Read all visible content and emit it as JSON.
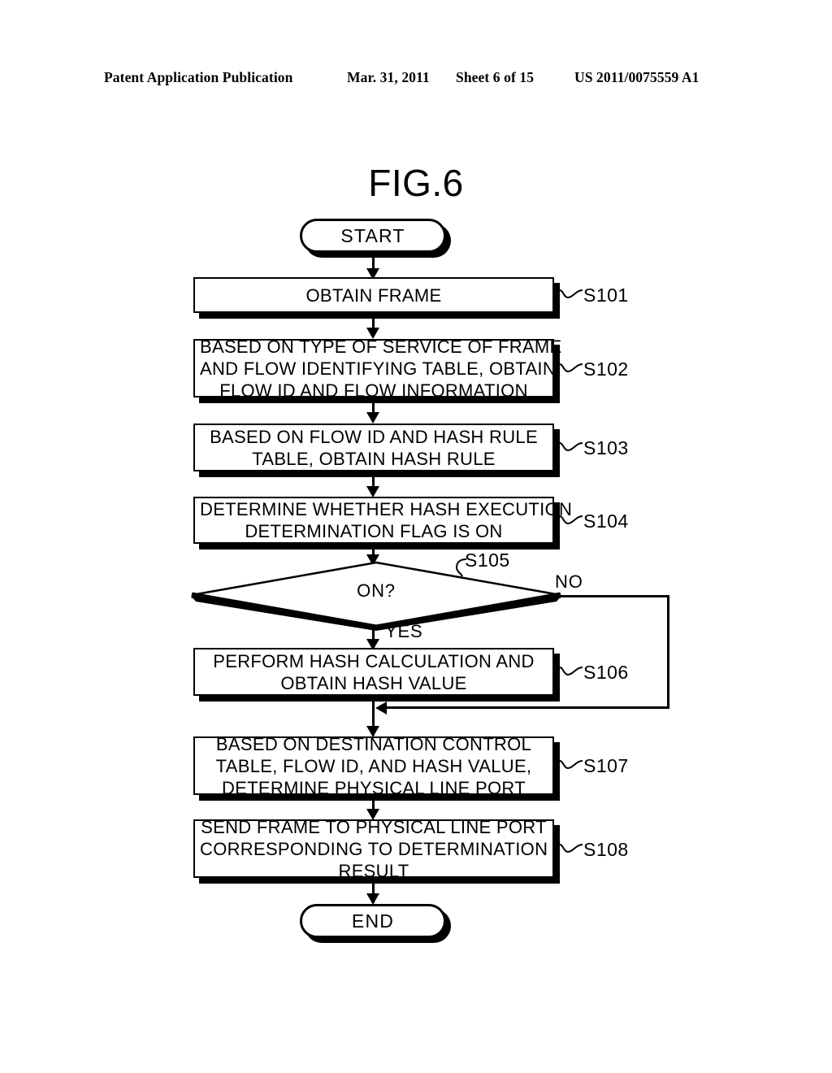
{
  "header": {
    "publication": "Patent Application Publication",
    "date": "Mar. 31, 2011",
    "sheet": "Sheet 6 of 15",
    "patent_number": "US 2011/0075559 A1"
  },
  "figure": {
    "title": "FIG.6",
    "type": "flowchart"
  },
  "flowchart": {
    "start": {
      "label": "START"
    },
    "end": {
      "label": "END"
    },
    "steps": [
      {
        "ref": "S101",
        "shape": "process",
        "lines": [
          "OBTAIN FRAME"
        ]
      },
      {
        "ref": "S102",
        "shape": "process",
        "lines": [
          "BASED ON TYPE OF SERVICE OF FRAME",
          "AND FLOW IDENTIFYING TABLE, OBTAIN",
          "FLOW ID AND FLOW INFORMATION"
        ]
      },
      {
        "ref": "S103",
        "shape": "process",
        "lines": [
          "BASED ON FLOW ID AND HASH RULE",
          "TABLE, OBTAIN HASH RULE"
        ]
      },
      {
        "ref": "S104",
        "shape": "process",
        "lines": [
          "DETERMINE WHETHER HASH EXECUTION",
          "DETERMINATION FLAG IS ON"
        ]
      },
      {
        "ref": "S105",
        "shape": "decision",
        "lines": [
          "ON?"
        ],
        "branch_yes": "YES",
        "branch_no": "NO"
      },
      {
        "ref": "S106",
        "shape": "process",
        "lines": [
          "PERFORM HASH CALCULATION AND",
          "OBTAIN HASH VALUE"
        ]
      },
      {
        "ref": "S107",
        "shape": "process",
        "lines": [
          "BASED ON DESTINATION CONTROL",
          "TABLE, FLOW ID, AND HASH VALUE,",
          "DETERMINE PHYSICAL LINE PORT"
        ]
      },
      {
        "ref": "S108",
        "shape": "process",
        "lines": [
          "SEND FRAME TO PHYSICAL LINE PORT",
          "CORRESPONDING TO DETERMINATION",
          "RESULT"
        ]
      }
    ]
  },
  "colors": {
    "ink": "#000000",
    "paper": "#ffffff"
  }
}
